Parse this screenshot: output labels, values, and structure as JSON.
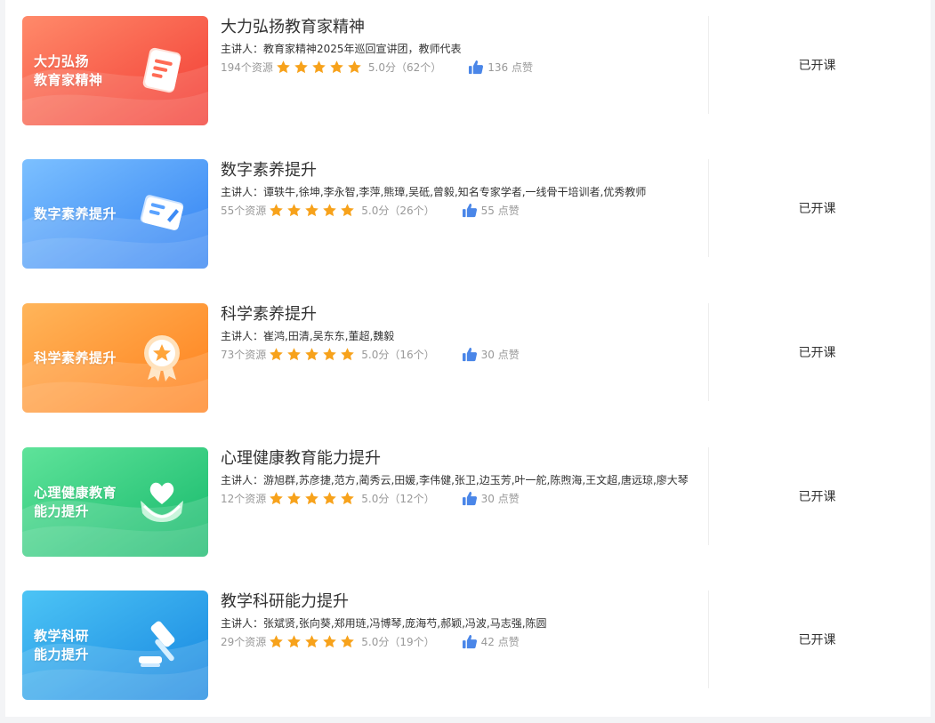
{
  "courses": [
    {
      "cover_text_lines": [
        "大力弘扬",
        "教育家精神"
      ],
      "cover_icon": "document-icon",
      "cover_colors": [
        "#ff7a5c",
        "#f0463a"
      ],
      "title": "大力弘扬教育家精神",
      "speaker": "主讲人：教育家精神2025年巡回宣讲团，教师代表",
      "resources": "194个资源",
      "rating": "5.0分",
      "rating_count": "（62个）",
      "likes": "136 点赞",
      "status": "已开课"
    },
    {
      "cover_text_lines": [
        "数字素养提升"
      ],
      "cover_icon": "certificate-card-icon",
      "cover_colors": [
        "#6db3ff",
        "#3d8bf5"
      ],
      "title": "数字素养提升",
      "speaker": "主讲人：谭轶牛,徐坤,李永智,李萍,熊璋,吴砥,曾毅,知名专家学者,一线骨干培训者,优秀教师",
      "resources": "55个资源",
      "rating": "5.0分",
      "rating_count": "（26个）",
      "likes": "55 点赞",
      "status": "已开课"
    },
    {
      "cover_text_lines": [
        "科学素养提升"
      ],
      "cover_icon": "award-badge-icon",
      "cover_colors": [
        "#ffb04d",
        "#ff8a1f"
      ],
      "title": "科学素养提升",
      "speaker": "主讲人：崔鸿,田清,吴东东,董超,魏毅",
      "resources": "73个资源",
      "rating": "5.0分",
      "rating_count": "（16个）",
      "likes": "30 点赞",
      "status": "已开课"
    },
    {
      "cover_text_lines": [
        "心理健康教育",
        "能力提升"
      ],
      "cover_icon": "heart-hands-icon",
      "cover_colors": [
        "#4fd68e",
        "#1fbf73"
      ],
      "title": "心理健康教育能力提升",
      "speaker": "主讲人：游旭群,苏彦捷,范方,蔺秀云,田媛,李伟健,张卫,边玉芳,叶一舵,陈煦海,王文超,唐远琼,廖大琴",
      "resources": "12个资源",
      "rating": "5.0分",
      "rating_count": "（12个）",
      "likes": "30 点赞",
      "status": "已开课"
    },
    {
      "cover_text_lines": [
        "教学科研",
        "能力提升"
      ],
      "cover_icon": "gavel-icon",
      "cover_colors": [
        "#45bdf2",
        "#1e8ee6"
      ],
      "title": "教学科研能力提升",
      "speaker": "主讲人：张斌贤,张向葵,郑用琏,冯博琴,庞海芍,郝颖,冯波,马志强,陈圆",
      "resources": "29个资源",
      "rating": "5.0分",
      "rating_count": "（19个）",
      "likes": "42 点赞",
      "status": "已开课"
    }
  ],
  "colors": {
    "star": "#f7a21b",
    "like": "#4a86e8",
    "meta_text": "#999999",
    "divider": "#eeeeee"
  }
}
